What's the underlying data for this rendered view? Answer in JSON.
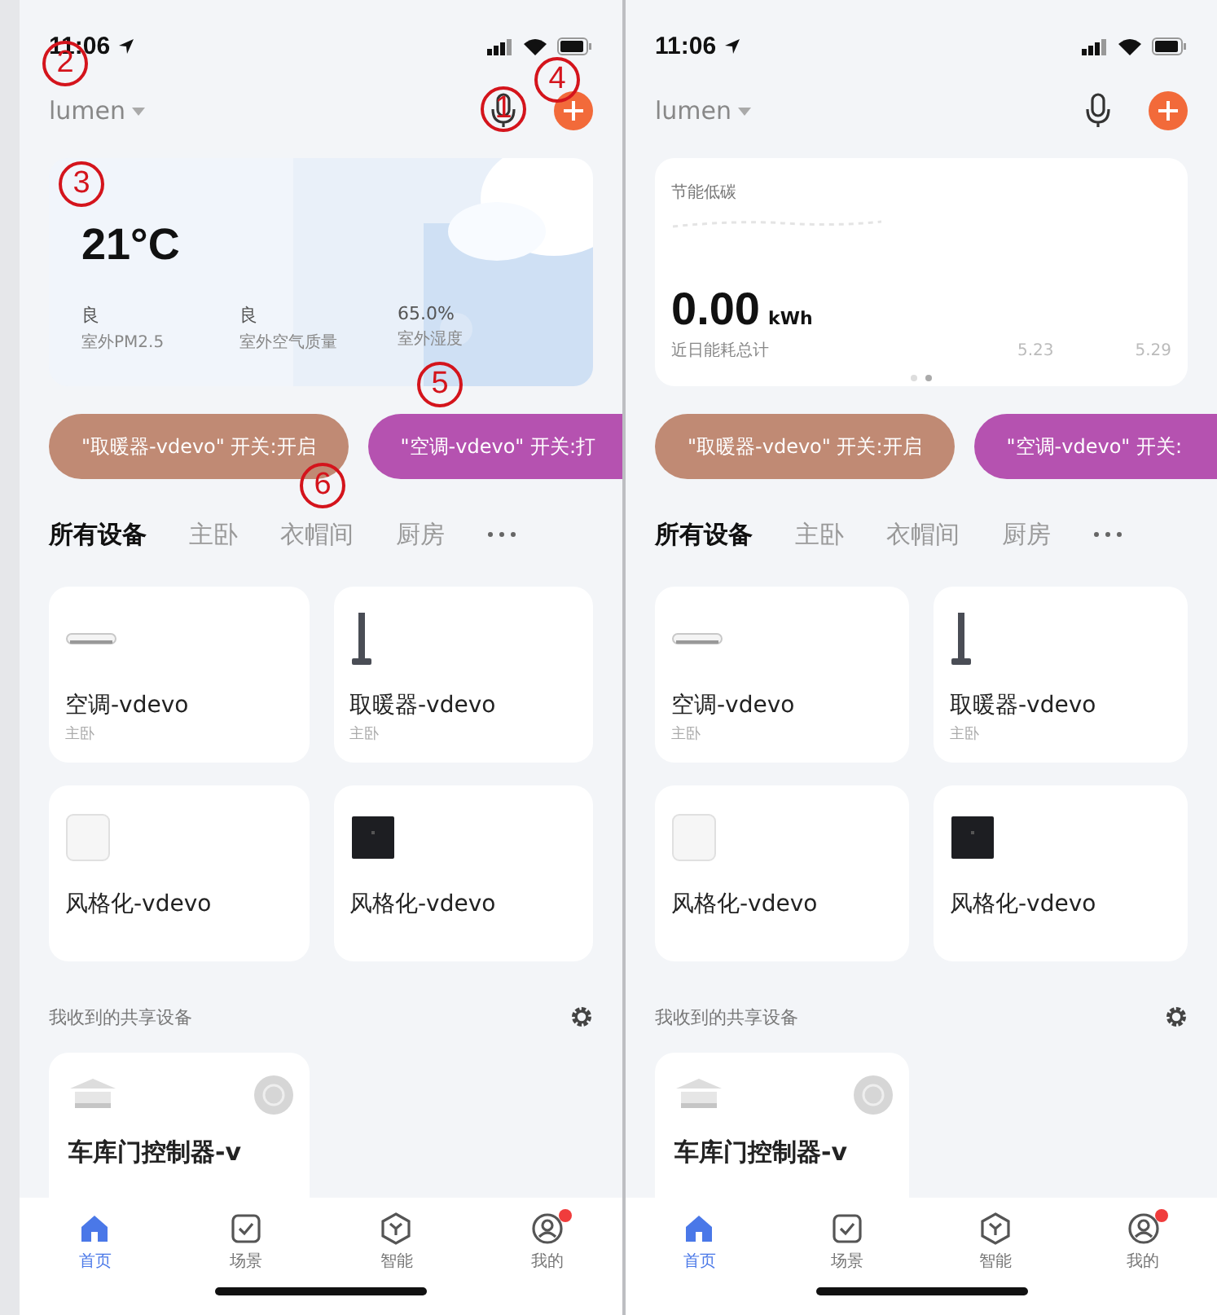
{
  "screens": [
    {
      "status": {
        "time": "11:06"
      },
      "header": {
        "home": {
          "label": "lumen",
          "annotation": "2"
        },
        "mic": {
          "annotation": "1"
        },
        "add": {
          "annotation": "4"
        }
      },
      "banner": {
        "kind": "weather",
        "annotation": "3",
        "temperature": "21°C",
        "stats": [
          {
            "value": "良",
            "label": "室外PM2.5"
          },
          {
            "value": "良",
            "label": "室外空气质量"
          },
          {
            "value": "65.0%",
            "label": "室外湿度"
          }
        ]
      },
      "scenes": {
        "annotation": "5",
        "items": [
          {
            "label": "\"取暖器-vdevo\" 开关:开启",
            "color": "#c08a74",
            "cut": false
          },
          {
            "label": "\"空调-vdevo\" 开关:打",
            "color": "#b552b0",
            "cut": true
          }
        ]
      },
      "tabs": [
        {
          "label": "所有设备",
          "selected": true
        },
        {
          "label": "主卧",
          "selected": false
        },
        {
          "label": "衣帽间",
          "selected": false,
          "annotation": "6"
        },
        {
          "label": "厨房",
          "selected": false
        }
      ],
      "devices": [
        {
          "kind": "ac",
          "name": "空调-vdevo",
          "room": "主卧"
        },
        {
          "kind": "heater",
          "name": "取暖器-vdevo",
          "room": "主卧"
        },
        {
          "kind": "speaker",
          "name": "风格化-vdevo"
        },
        {
          "kind": "panel",
          "name": "风格化-vdevo"
        }
      ],
      "shared": {
        "title": "我收到的共享设备",
        "devices": [
          {
            "kind": "garage",
            "name": "车库门控制器-v"
          }
        ]
      },
      "tabbar": [
        {
          "kind": "home",
          "label": "首页",
          "selected": true,
          "badge": false
        },
        {
          "kind": "scene",
          "label": "场景",
          "selected": false,
          "badge": false
        },
        {
          "kind": "smart",
          "label": "智能",
          "selected": false,
          "badge": false
        },
        {
          "kind": "profile",
          "label": "我的",
          "selected": false,
          "badge": true
        }
      ]
    },
    {
      "status": {
        "time": "11:06"
      },
      "header": {
        "home": {
          "label": "lumen"
        }
      },
      "banner": {
        "kind": "energy",
        "title": "节能低碳",
        "value": "0.00",
        "unit": "kWh",
        "caption": "近日能耗总计",
        "axis_labels": [
          "5.23",
          "5.29"
        ],
        "pages": [
          {
            "selected": false
          },
          {
            "selected": true
          }
        ]
      },
      "scenes": {
        "items": [
          {
            "label": "\"取暖器-vdevo\" 开关:开启",
            "color": "#c08a74",
            "cut": false
          },
          {
            "label": "\"空调-vdevo\" 开关:",
            "color": "#b552b0",
            "cut": true
          }
        ]
      },
      "tabs": [
        {
          "label": "所有设备",
          "selected": true
        },
        {
          "label": "主卧",
          "selected": false
        },
        {
          "label": "衣帽间",
          "selected": false
        },
        {
          "label": "厨房",
          "selected": false
        }
      ],
      "devices": [
        {
          "kind": "ac",
          "name": "空调-vdevo",
          "room": "主卧"
        },
        {
          "kind": "heater",
          "name": "取暖器-vdevo",
          "room": "主卧"
        },
        {
          "kind": "speaker",
          "name": "风格化-vdevo"
        },
        {
          "kind": "panel",
          "name": "风格化-vdevo"
        }
      ],
      "shared": {
        "title": "我收到的共享设备",
        "devices": [
          {
            "kind": "garage",
            "name": "车库门控制器-v"
          }
        ]
      },
      "tabbar": [
        {
          "kind": "home",
          "label": "首页",
          "selected": true,
          "badge": false
        },
        {
          "kind": "scene",
          "label": "场景",
          "selected": false,
          "badge": false
        },
        {
          "kind": "smart",
          "label": "智能",
          "selected": false,
          "badge": false
        },
        {
          "kind": "profile",
          "label": "我的",
          "selected": false,
          "badge": true
        }
      ]
    }
  ]
}
